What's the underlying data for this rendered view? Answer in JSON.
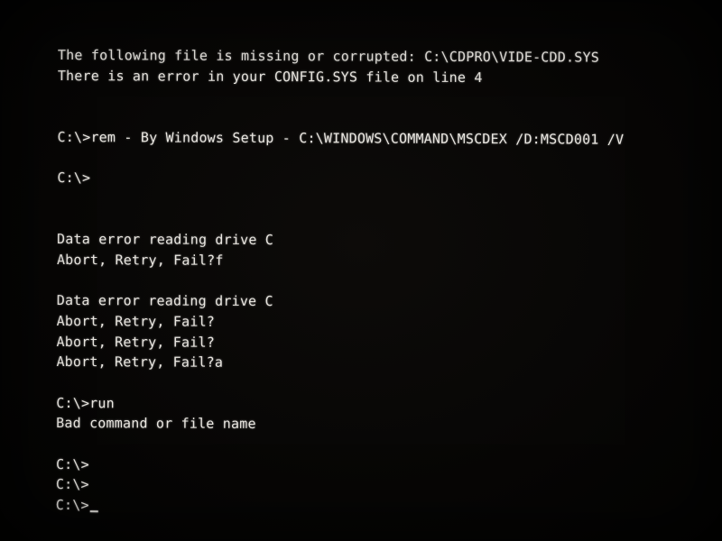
{
  "terminal": {
    "lines": [
      "The following file is missing or corrupted: C:\\CDPRO\\VIDE-CDD.SYS",
      "There is an error in your CONFIG.SYS file on line 4",
      "",
      "",
      "C:\\>rem - By Windows Setup - C:\\WINDOWS\\COMMAND\\MSCDEX /D:MSCD001 /V",
      "",
      "C:\\>",
      "",
      "",
      "Data error reading drive C",
      "Abort, Retry, Fail?f",
      "",
      "Data error reading drive C",
      "Abort, Retry, Fail?",
      "Abort, Retry, Fail?",
      "Abort, Retry, Fail?a",
      "",
      "C:\\>run",
      "Bad command or file name",
      "",
      "C:\\>",
      "C:\\>",
      "C:\\>"
    ]
  }
}
